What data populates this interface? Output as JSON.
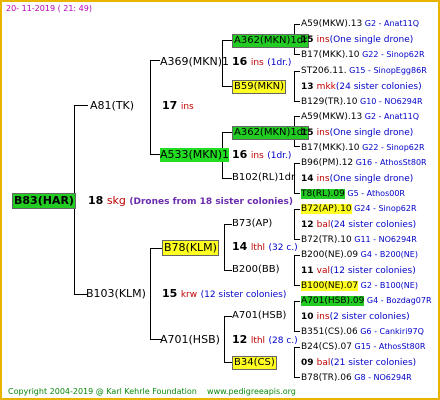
{
  "header": {
    "timestamp": "20- 11-2019 ( 21: 49)"
  },
  "root": {
    "name": "B83(HAR)",
    "num": "18",
    "race": "skg",
    "note": "(Drones from 18 sister colonies)"
  },
  "gen2": [
    {
      "name": "A81(TK)",
      "num": "17",
      "race": "ins"
    },
    {
      "name": "B103(KLM)",
      "num": "15",
      "race": "krw",
      "note": "(12 sister colonies)"
    }
  ],
  "gen3": [
    {
      "name": "A369(MKN)1",
      "num": "16",
      "race": "ins",
      "note": "(1dr.)"
    },
    {
      "name": "A533(MKN)1",
      "num": "16",
      "race": "ins",
      "note": "(1dr.)"
    },
    {
      "name": "B78(KLM)",
      "num": "14",
      "race": "lthl",
      "note": "(32 c.)"
    },
    {
      "name": "A701(HSB)",
      "num": "12",
      "race": "lthl",
      "note": "(28 c.)"
    }
  ],
  "gen4": [
    {
      "name": "A362(MKN)1dr"
    },
    {
      "name": "B59(MKN)"
    },
    {
      "name": "A362(MKN)1dr"
    },
    {
      "name": "B102(RL)1dr"
    },
    {
      "name": "B73(AP)"
    },
    {
      "name": "B200(BB)"
    },
    {
      "name": "A701(HSB)"
    },
    {
      "name": "B34(CS)"
    }
  ],
  "gen5": [
    {
      "text": "A59(MKW).13",
      "tag": "G2 - Anat11Q",
      "hl": ""
    },
    {
      "num": "15",
      "race": "ins",
      "note": "(One single drone)"
    },
    {
      "text": "B17(MKK).10",
      "tag": "G22 - Sinop62R",
      "hl": ""
    },
    {
      "text": "ST206.11.",
      "tag": "G15 - SinopEgg86R",
      "hl": ""
    },
    {
      "num": "13",
      "race": "mkk",
      "note": "(24 sister colonies)"
    },
    {
      "text": "B129(TR).10",
      "tag": "G10 - NO6294R",
      "hl": ""
    },
    {
      "text": "A59(MKW).13",
      "tag": "G2 - Anat11Q",
      "hl": ""
    },
    {
      "num": "15",
      "race": "ins",
      "note": "(One single drone)"
    },
    {
      "text": "B17(MKK).10",
      "tag": "G22 - Sinop62R",
      "hl": ""
    },
    {
      "text": "B96(PM).12",
      "tag": "G16 - AthosSt80R",
      "hl": ""
    },
    {
      "num": "14",
      "race": "ins",
      "note": "(One single drone)"
    },
    {
      "text": "T8(RL).09",
      "tag": "G5 - Athos00R",
      "hl": "green"
    },
    {
      "text": "B72(AP).10",
      "tag": "G24 - Sinop62R",
      "hl": "yellow"
    },
    {
      "num": "12",
      "race": "bal",
      "note": "(24 sister colonies)"
    },
    {
      "text": "B72(TR).10",
      "tag": "G11 - NO6294R",
      "hl": ""
    },
    {
      "text": "B200(NE).09",
      "tag": "G4 - B200(NE)",
      "hl": ""
    },
    {
      "num": "11",
      "race": "val",
      "note": "(12 sister colonies)"
    },
    {
      "text": "B100(NE).07",
      "tag": "G2 - B100(NE)",
      "hl": "yellow"
    },
    {
      "text": "A701(HSB).09",
      "tag": "G4 - Bozdag07R",
      "hl": "green"
    },
    {
      "num": "10",
      "race": "ins",
      "note": "(2 sister colonies)"
    },
    {
      "text": "B351(CS).06",
      "tag": "G6 - Cankiri97Q",
      "hl": ""
    },
    {
      "text": "B24(CS).07",
      "tag": "G15 - AthosSt80R",
      "hl": ""
    },
    {
      "num": "09",
      "race": "bal",
      "note": "(21 sister colonies)"
    },
    {
      "text": "B78(TR).06",
      "tag": "G8 - NO6294R",
      "hl": ""
    }
  ],
  "footer": {
    "copyright": "Copyright 2004-2019 @ Karl Kehrle Foundation",
    "site": "www.pedigreeapis.org"
  }
}
